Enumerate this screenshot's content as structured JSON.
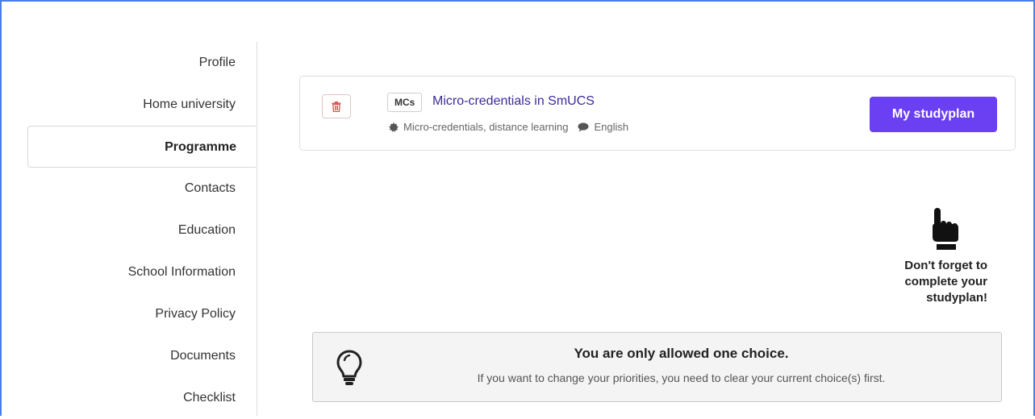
{
  "sidebar": {
    "items": [
      {
        "label": "Profile",
        "active": false
      },
      {
        "label": "Home university",
        "active": false
      },
      {
        "label": "Programme",
        "active": true
      },
      {
        "label": "Contacts",
        "active": false
      },
      {
        "label": "Education",
        "active": false
      },
      {
        "label": "School Information",
        "active": false
      },
      {
        "label": "Privacy Policy",
        "active": false
      },
      {
        "label": "Documents",
        "active": false
      },
      {
        "label": "Checklist",
        "active": false
      }
    ]
  },
  "programme": {
    "badge": "MCs",
    "title": "Micro-credentials in SmUCS",
    "type": "Micro-credentials, distance learning",
    "language": "English",
    "delete_icon": "trash-icon",
    "studyplan_label": "My studyplan"
  },
  "hint": {
    "icon": "pointing-hand-icon",
    "text": "Don't forget to complete your studyplan!"
  },
  "notice": {
    "icon": "lightbulb-icon",
    "title": "You are only allowed one choice.",
    "body": "If you want to change your priorities, you need to clear your current choice(s) first."
  },
  "colors": {
    "accent": "#6b3ff2",
    "link": "#3d2a9b",
    "delete": "#d9534f",
    "frame": "#4a7ee6"
  }
}
